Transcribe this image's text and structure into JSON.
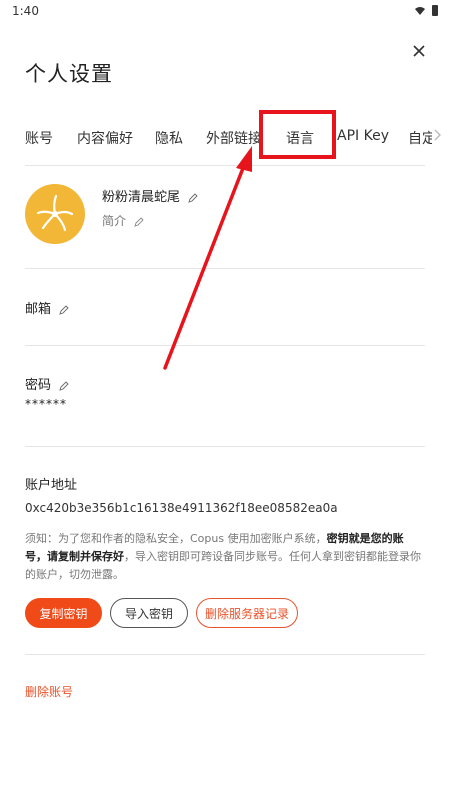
{
  "status_bar": {
    "time": "1:40",
    "icons": [
      "wifi-icon",
      "battery-icon"
    ]
  },
  "header": {
    "title": "个人设置",
    "close_icon": "close-icon"
  },
  "tabs": [
    {
      "label": "账号"
    },
    {
      "label": "内容偏好"
    },
    {
      "label": "隐私"
    },
    {
      "label": "外部链接"
    },
    {
      "label": "语言"
    },
    {
      "label": "API Key"
    },
    {
      "label": "自定义"
    }
  ],
  "profile": {
    "username": "粉粉清晨蛇尾",
    "bio_label": "简介",
    "edit_icon": "pencil-icon"
  },
  "email": {
    "label": "邮箱"
  },
  "password": {
    "label": "密码",
    "masked": "******"
  },
  "account": {
    "label": "账户地址",
    "address": "0xc420b3e356b1c16138e4911362f18ee08582ea0a",
    "notice_1": "须知：为了您和作者的隐私安全，Copus 使用加密账户系统，",
    "notice_bold": "密钥就是您的账号，请复制并保存好",
    "notice_2": "，导入密钥即可跨设备同步账号。任何人拿到密钥都能登录你的账户，切勿泄露。"
  },
  "buttons": {
    "copy_key": "复制密钥",
    "import_key": "导入密钥",
    "delete_records": "删除服务器记录"
  },
  "danger": {
    "delete_account": "删除账号"
  },
  "colors": {
    "accent": "#f04a19",
    "annotation_red": "#e8141c",
    "avatar_bg": "#f3b737"
  }
}
